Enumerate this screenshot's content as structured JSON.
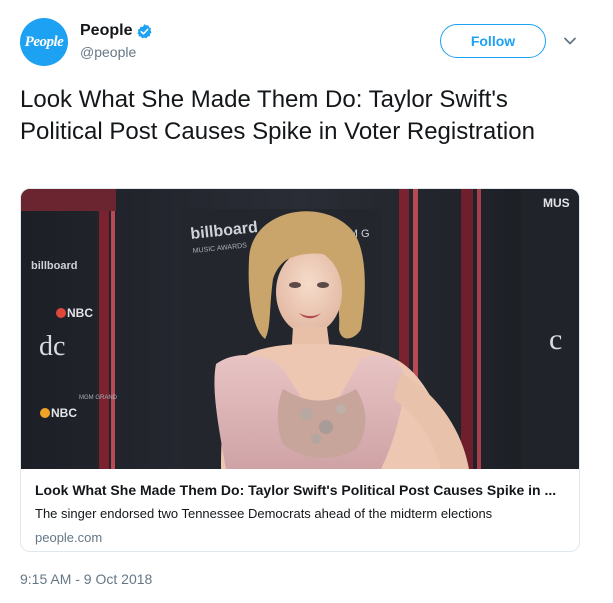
{
  "author": {
    "avatar_text": "People",
    "display_name": "People",
    "handle": "@people",
    "verified_icon": "verified-badge-icon"
  },
  "actions": {
    "follow_label": "Follow",
    "menu_icon": "chevron-down-icon"
  },
  "tweet": {
    "text": "Look What She Made Them Do: Taylor Swift's Political Post Causes Spike in Voter Registration",
    "timestamp": "9:15 AM - 9 Oct 2018"
  },
  "card": {
    "title": "Look What She Made Them Do: Taylor Swift's Political Post Causes Spike in ...",
    "description": "The singer endorsed two Tennessee Democrats ahead of the midterm elections",
    "domain": "people.com",
    "image_backdrop_text": [
      "billboard",
      "MUSIC AWARDS",
      "NBC",
      "MGM GRAND",
      "MUS"
    ]
  },
  "colors": {
    "accent": "#1da1f2",
    "text": "#14171a",
    "secondary": "#657786",
    "border": "#e1e8ed"
  }
}
